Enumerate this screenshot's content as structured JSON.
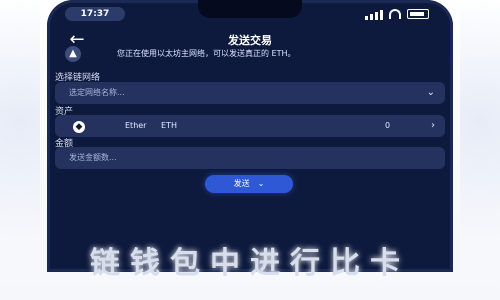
{
  "status_bar": {
    "time": "17:37"
  },
  "nav": {
    "title": "发送交易"
  },
  "banner": {
    "text": "您正在使用以太坊主网络，可以发送真正的 ETH。"
  },
  "chain": {
    "label": "选择链网络",
    "placeholder": "选定网络名称..."
  },
  "asset": {
    "label": "资产",
    "token_name": "Ether",
    "token_symbol": "ETH",
    "balance": "0"
  },
  "recipient": {
    "label": "金额",
    "placeholder": "发送金额数..."
  },
  "send_button": {
    "label": "发送"
  },
  "caption": {
    "text": "链钱包中进行比卡"
  }
}
